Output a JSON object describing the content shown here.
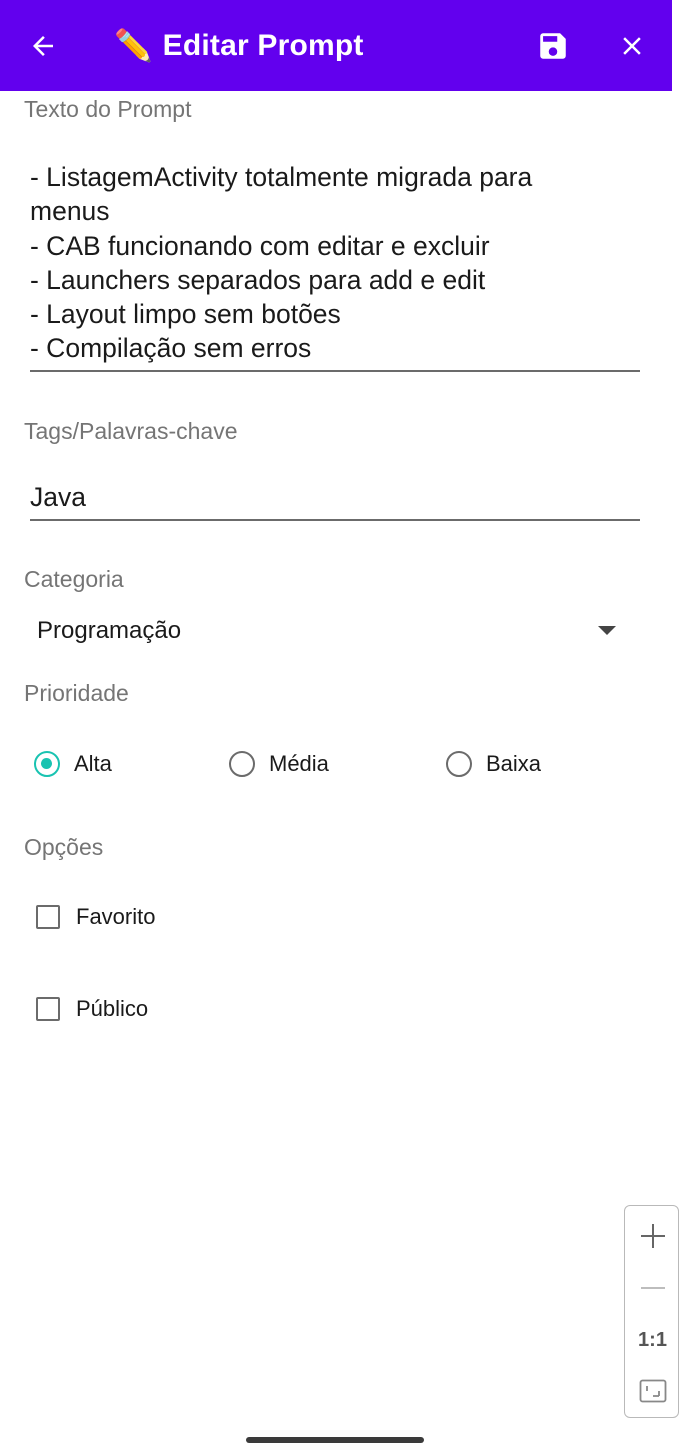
{
  "toolbar": {
    "title_emoji": "✏️",
    "title": "Editar Prompt",
    "background": "#6200ee",
    "back_icon": "arrow-left-icon",
    "save_icon": "floppy-disk-icon",
    "close_icon": "close-icon"
  },
  "prompt": {
    "label": "Texto do Prompt",
    "lines": [
      "- ListagemActivity totalmente migrada para",
      "menus",
      "- CAB funcionando com editar e excluir",
      "- Launchers separados para add e edit",
      "- Layout limpo sem botões",
      "- Compilação sem erros"
    ]
  },
  "tags": {
    "label": "Tags/Palavras-chave",
    "value": "Java"
  },
  "categoria": {
    "label": "Categoria",
    "selected": "Programação"
  },
  "prioridade": {
    "label": "Prioridade",
    "options": [
      "Alta",
      "Média",
      "Baixa"
    ],
    "selected": "Alta",
    "accent": "#19c3b1"
  },
  "opcoes": {
    "label": "Opções",
    "favorito": "Favorito",
    "favorito_checked": false,
    "publico": "Público",
    "publico_checked": false
  },
  "zoom": {
    "reset_label": "1:1"
  }
}
